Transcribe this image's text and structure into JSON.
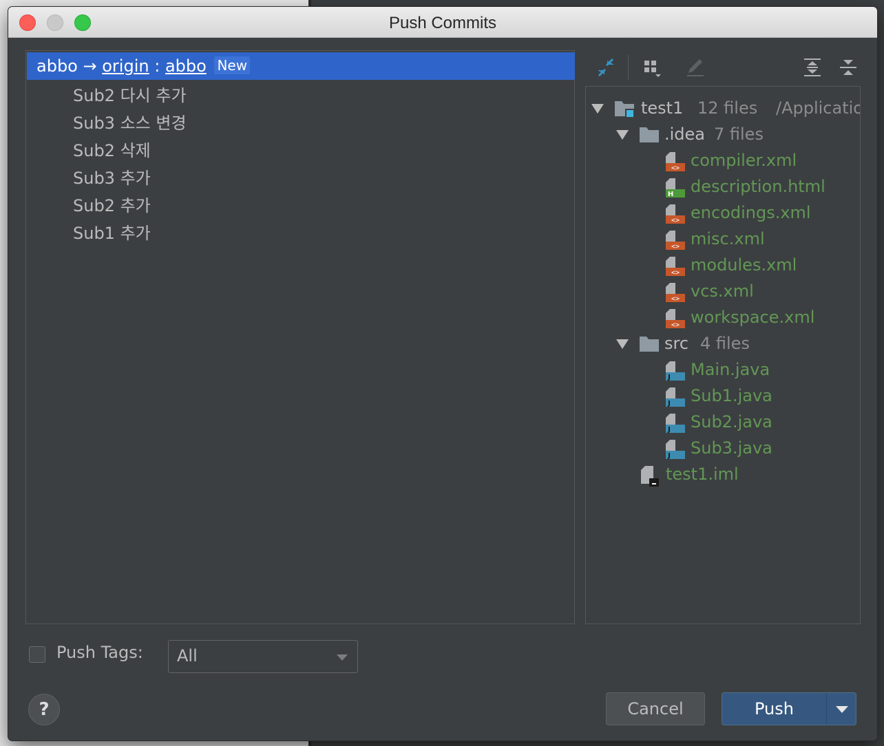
{
  "window": {
    "title": "Push Commits"
  },
  "branch": {
    "local": "abbo",
    "arrow": "→",
    "remote": "origin",
    "separator": ":",
    "remote_branch": "abbo",
    "badge": "New"
  },
  "commits": [
    "Sub2 다시 추가",
    "Sub3 소스 변경",
    "Sub2 삭제",
    "Sub3 추가",
    "Sub2 추가",
    "Sub1 추가"
  ],
  "tree": {
    "root": {
      "name": "test1",
      "count": "12 files",
      "path": "/Applicatio"
    },
    "idea": {
      "name": ".idea",
      "count": "7 files"
    },
    "idea_files": [
      {
        "name": "compiler.xml",
        "icon": "xml-file-icon"
      },
      {
        "name": "description.html",
        "icon": "html-file-icon"
      },
      {
        "name": "encodings.xml",
        "icon": "xml-file-icon"
      },
      {
        "name": "misc.xml",
        "icon": "xml-file-icon"
      },
      {
        "name": "modules.xml",
        "icon": "xml-file-icon"
      },
      {
        "name": "vcs.xml",
        "icon": "xml-file-icon"
      },
      {
        "name": "workspace.xml",
        "icon": "xml-file-icon"
      }
    ],
    "src": {
      "name": "src",
      "count": "4 files"
    },
    "src_files": [
      {
        "name": "Main.java",
        "icon": "java-file-icon"
      },
      {
        "name": "Sub1.java",
        "icon": "java-file-icon"
      },
      {
        "name": "Sub2.java",
        "icon": "java-file-icon"
      },
      {
        "name": "Sub3.java",
        "icon": "java-file-icon"
      }
    ],
    "iml": {
      "name": "test1.iml",
      "icon": "iml-file-icon"
    }
  },
  "footer": {
    "push_tags_label": "Push Tags:",
    "push_tags_value": "All",
    "help": "?",
    "cancel": "Cancel",
    "push": "Push"
  },
  "colors": {
    "selection": "#2f65ca",
    "added_file": "#629755",
    "push_button": "#365880",
    "xml_icon": "#c6572b",
    "html_icon": "#4e9a3a",
    "java_icon": "#3d8bb0"
  }
}
